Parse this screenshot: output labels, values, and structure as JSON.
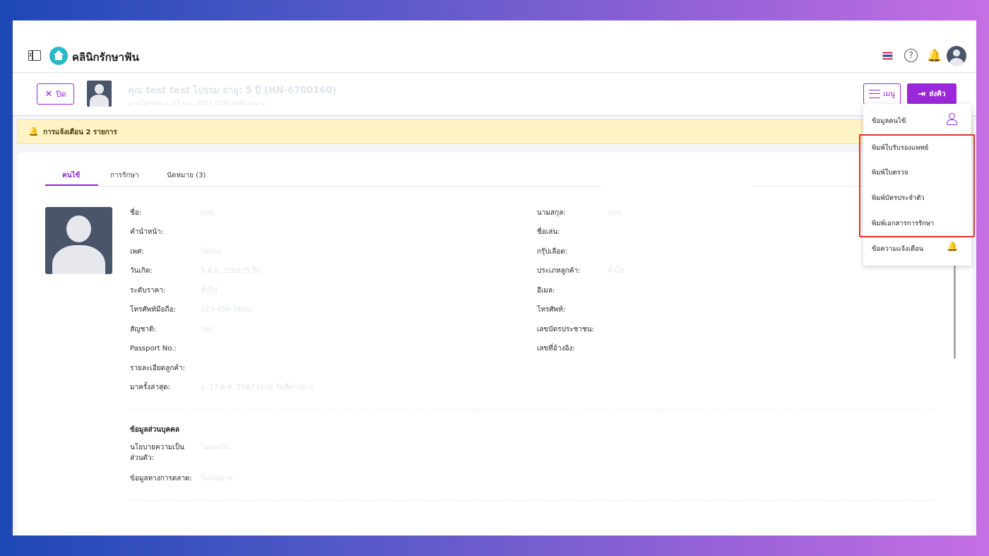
{
  "app": {
    "brand": "คลินิกรักษาฟัน",
    "colors": {
      "accent": "#9b28d8",
      "alert_bg": "#fdf3c4",
      "avatar_bg": "#4b5569",
      "highlight": "#e03131"
    }
  },
  "nav": {
    "icons": [
      "sidebar-toggle-icon",
      "thailand-flag-icon",
      "help-icon",
      "bell-icon",
      "user-avatar"
    ],
    "help_glyph": "?",
    "bell_glyph": "🔔"
  },
  "patient": {
    "title": "คุณ test test  ไปรรม  อายุ: 5 ปี  (HN-6700160)",
    "subtitle": "มาครั้งล่าสุด อ. 17 ต.ค. 2567 (108 วันที่ผ่านมา)",
    "close_label": "ปิด",
    "close_glyph": "✕",
    "menu_label": "เมนู",
    "send_label": "ส่งคิว",
    "send_glyph": "⇥"
  },
  "alert": {
    "glyph": "🔔",
    "text": "การแจ้งเตือน 2 รายการ"
  },
  "tabs": [
    {
      "label": "คนไข้",
      "active": true
    },
    {
      "label": "การรักษา",
      "active": false
    },
    {
      "label": "นัดหมาย (3)",
      "active": false
    }
  ],
  "fields_left": [
    {
      "label": "ชื่อ:",
      "value": "test"
    },
    {
      "label": "คำนำหน้า:",
      "value": ""
    },
    {
      "label": "เพศ:",
      "value": "ไม่ระบุ"
    },
    {
      "label": "วันเกิด:",
      "value": "5 มิ.ย. 2562 (5 ปี)"
    },
    {
      "label": "ระดับราคา:",
      "value": "ทั่วไป"
    },
    {
      "label": "โทรศัพท์มือถือ:",
      "value": "123-456-7890"
    },
    {
      "label": "สัญชาติ:",
      "value": "ไทย"
    },
    {
      "label": "Passport No.:",
      "value": ""
    },
    {
      "label": "รายละเอียดลูกค้า:",
      "value": ""
    },
    {
      "label": "มาครั้งล่าสุด:",
      "value": "อ. 17 ต.ค. 2567 (108 วันที่ผ่านมา)"
    }
  ],
  "fields_right": [
    {
      "label": "นามสกุล:",
      "value": "test"
    },
    {
      "label": "ชื่อเล่น:",
      "value": ""
    },
    {
      "label": "กรุ๊ปเลือด:",
      "value": ""
    },
    {
      "label": "ประเภทลูกค้า:",
      "value": "ทั่วไป"
    },
    {
      "label": "อีเมล:",
      "value": ""
    },
    {
      "label": "โทรศัพท์:",
      "value": ""
    },
    {
      "label": "เลขบัตรประชาชน:",
      "value": ""
    },
    {
      "label": "เลขที่อ้างอิง:",
      "value": ""
    }
  ],
  "personal": {
    "title": "ข้อมูลส่วนบุคคล",
    "policy_label": "นโยบายความเป็น\nส่วนตัว:",
    "policy_value": "ไม่ยอมรับ",
    "marketing_label": "ข้อมูลทางการตลาด:",
    "marketing_value": "ไม่อนุญาต"
  },
  "dropdown": {
    "items": [
      {
        "label": "ข้อมูลคนไข้",
        "icon": "person-icon"
      },
      {
        "label": "พิมพ์ใบรับรองแพทย์",
        "icon": ""
      },
      {
        "label": "พิมพ์ใบตรวจ",
        "icon": ""
      },
      {
        "label": "พิมพ์บัตรประจำตัว",
        "icon": ""
      },
      {
        "label": "พิมพ์เอกสารการรักษา",
        "icon": ""
      },
      {
        "label": "ข้อความแจ้งเตือน",
        "icon": "bell-icon"
      }
    ],
    "bell_glyph": "🔔"
  }
}
